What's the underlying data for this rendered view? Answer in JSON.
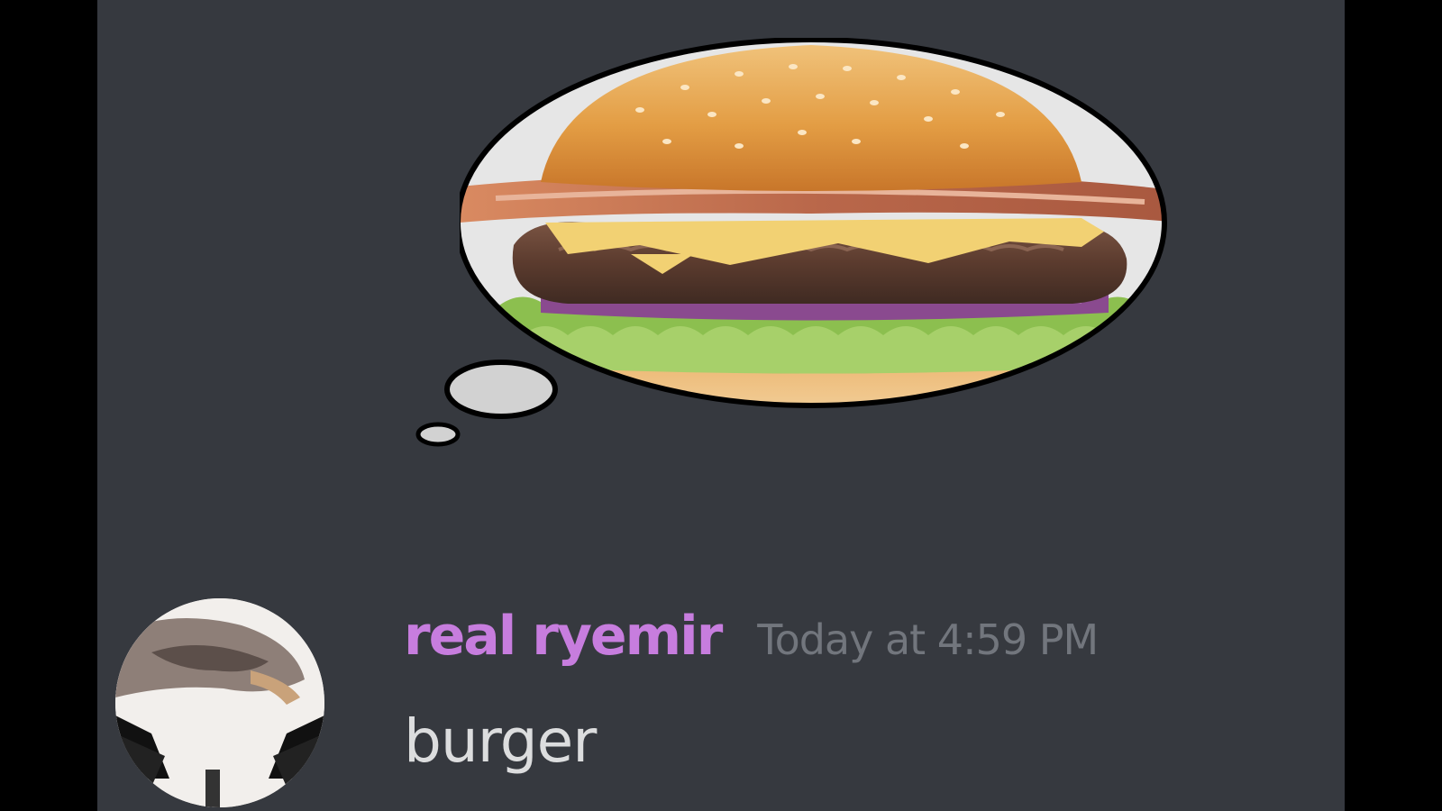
{
  "colors": {
    "page_background": "#000000",
    "chat_background": "#36393f",
    "username": "#c77dde",
    "timestamp": "#72767d",
    "message_text": "#dcddde"
  },
  "thought_bubble": {
    "image": "burger-image",
    "icon": "thought-bubble-icon"
  },
  "message": {
    "avatar_icon": "avatar-image",
    "username": "real ryemir",
    "timestamp": "Today at 4:59 PM",
    "content": "burger"
  }
}
